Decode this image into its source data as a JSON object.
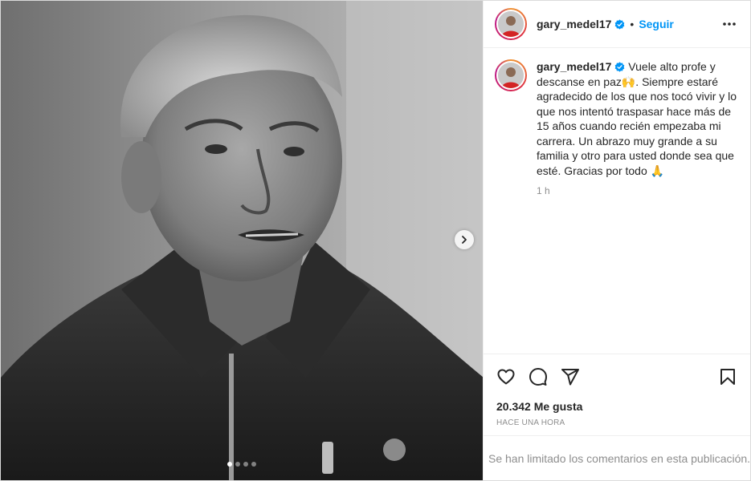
{
  "post": {
    "username": "gary_medel17",
    "follow_label": "Seguir",
    "separator": "•",
    "caption": "Vuele alto profe y descanse en paz🙌. Siempre estaré agradecido de los que nos tocó vivir y lo que nos intentó traspasar hace más de 15 años cuando recién empezaba mi carrera. Un abrazo muy grande a su familia y otro para usted donde sea que esté. Gracias por todo 🙏",
    "caption_time": "1 h",
    "likes": "20.342 Me gusta",
    "posted_ago": "HACE UNA HORA",
    "comments_notice": "Se han limitado los comentarios en esta publicación.",
    "carousel": {
      "slides": 4,
      "active_index": 0
    }
  },
  "icons": {
    "verified": "verified-badge-icon",
    "more": "more-options-icon",
    "like": "heart-icon",
    "comment": "comment-icon",
    "share": "share-icon",
    "save": "bookmark-icon",
    "next": "chevron-right-icon"
  },
  "colors": {
    "link_blue": "#0095f6",
    "verified_blue": "#0095f6",
    "text": "#262626",
    "secondary_text": "#8e8e8e",
    "border": "#dbdbdb"
  }
}
